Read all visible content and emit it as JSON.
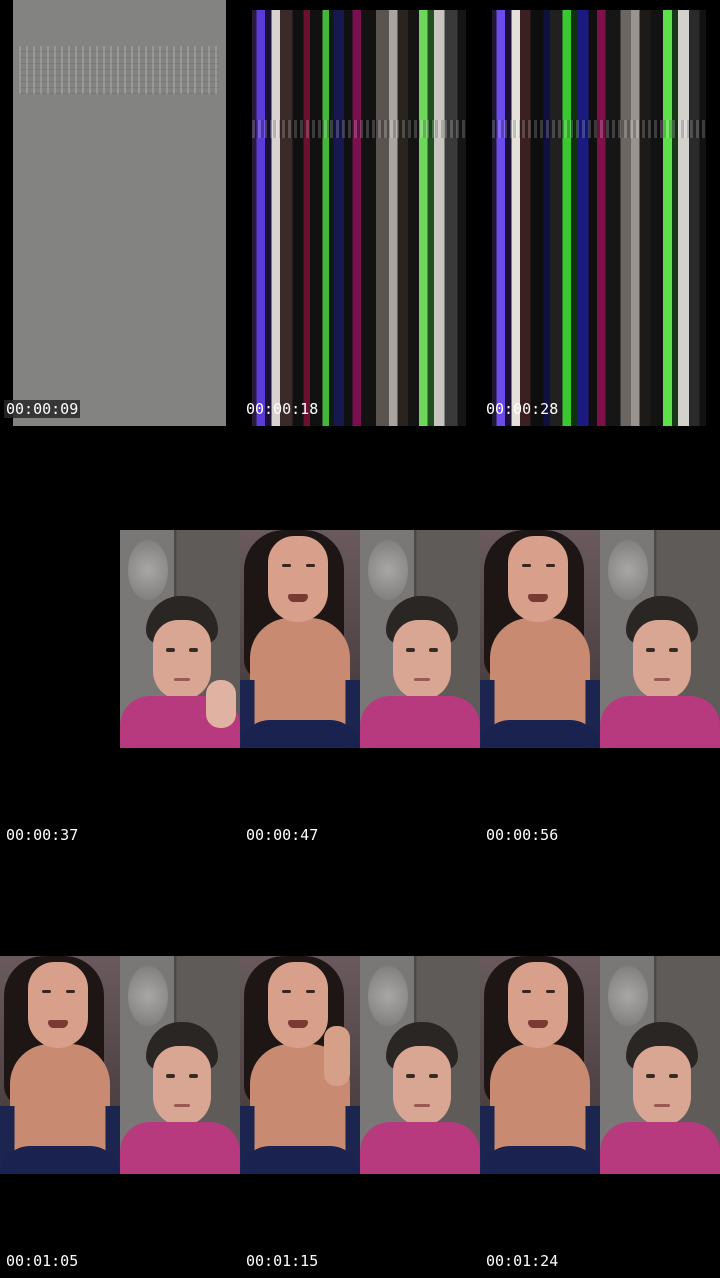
{
  "frames": [
    {
      "timestamp": "00:00:09",
      "kind": "gray-glitch"
    },
    {
      "timestamp": "00:00:18",
      "kind": "stripe-glitch"
    },
    {
      "timestamp": "00:00:28",
      "kind": "stripe-glitch"
    },
    {
      "timestamp": "00:00:37",
      "kind": "video"
    },
    {
      "timestamp": "00:00:47",
      "kind": "video"
    },
    {
      "timestamp": "00:00:56",
      "kind": "video"
    },
    {
      "timestamp": "00:01:05",
      "kind": "video"
    },
    {
      "timestamp": "00:01:15",
      "kind": "video"
    },
    {
      "timestamp": "00:01:24",
      "kind": "video"
    }
  ],
  "colors": {
    "background": "#000000",
    "timestamp_text": "#ffffff",
    "man_shirt": "#b83a7e",
    "woman_top": "#1a2250"
  }
}
